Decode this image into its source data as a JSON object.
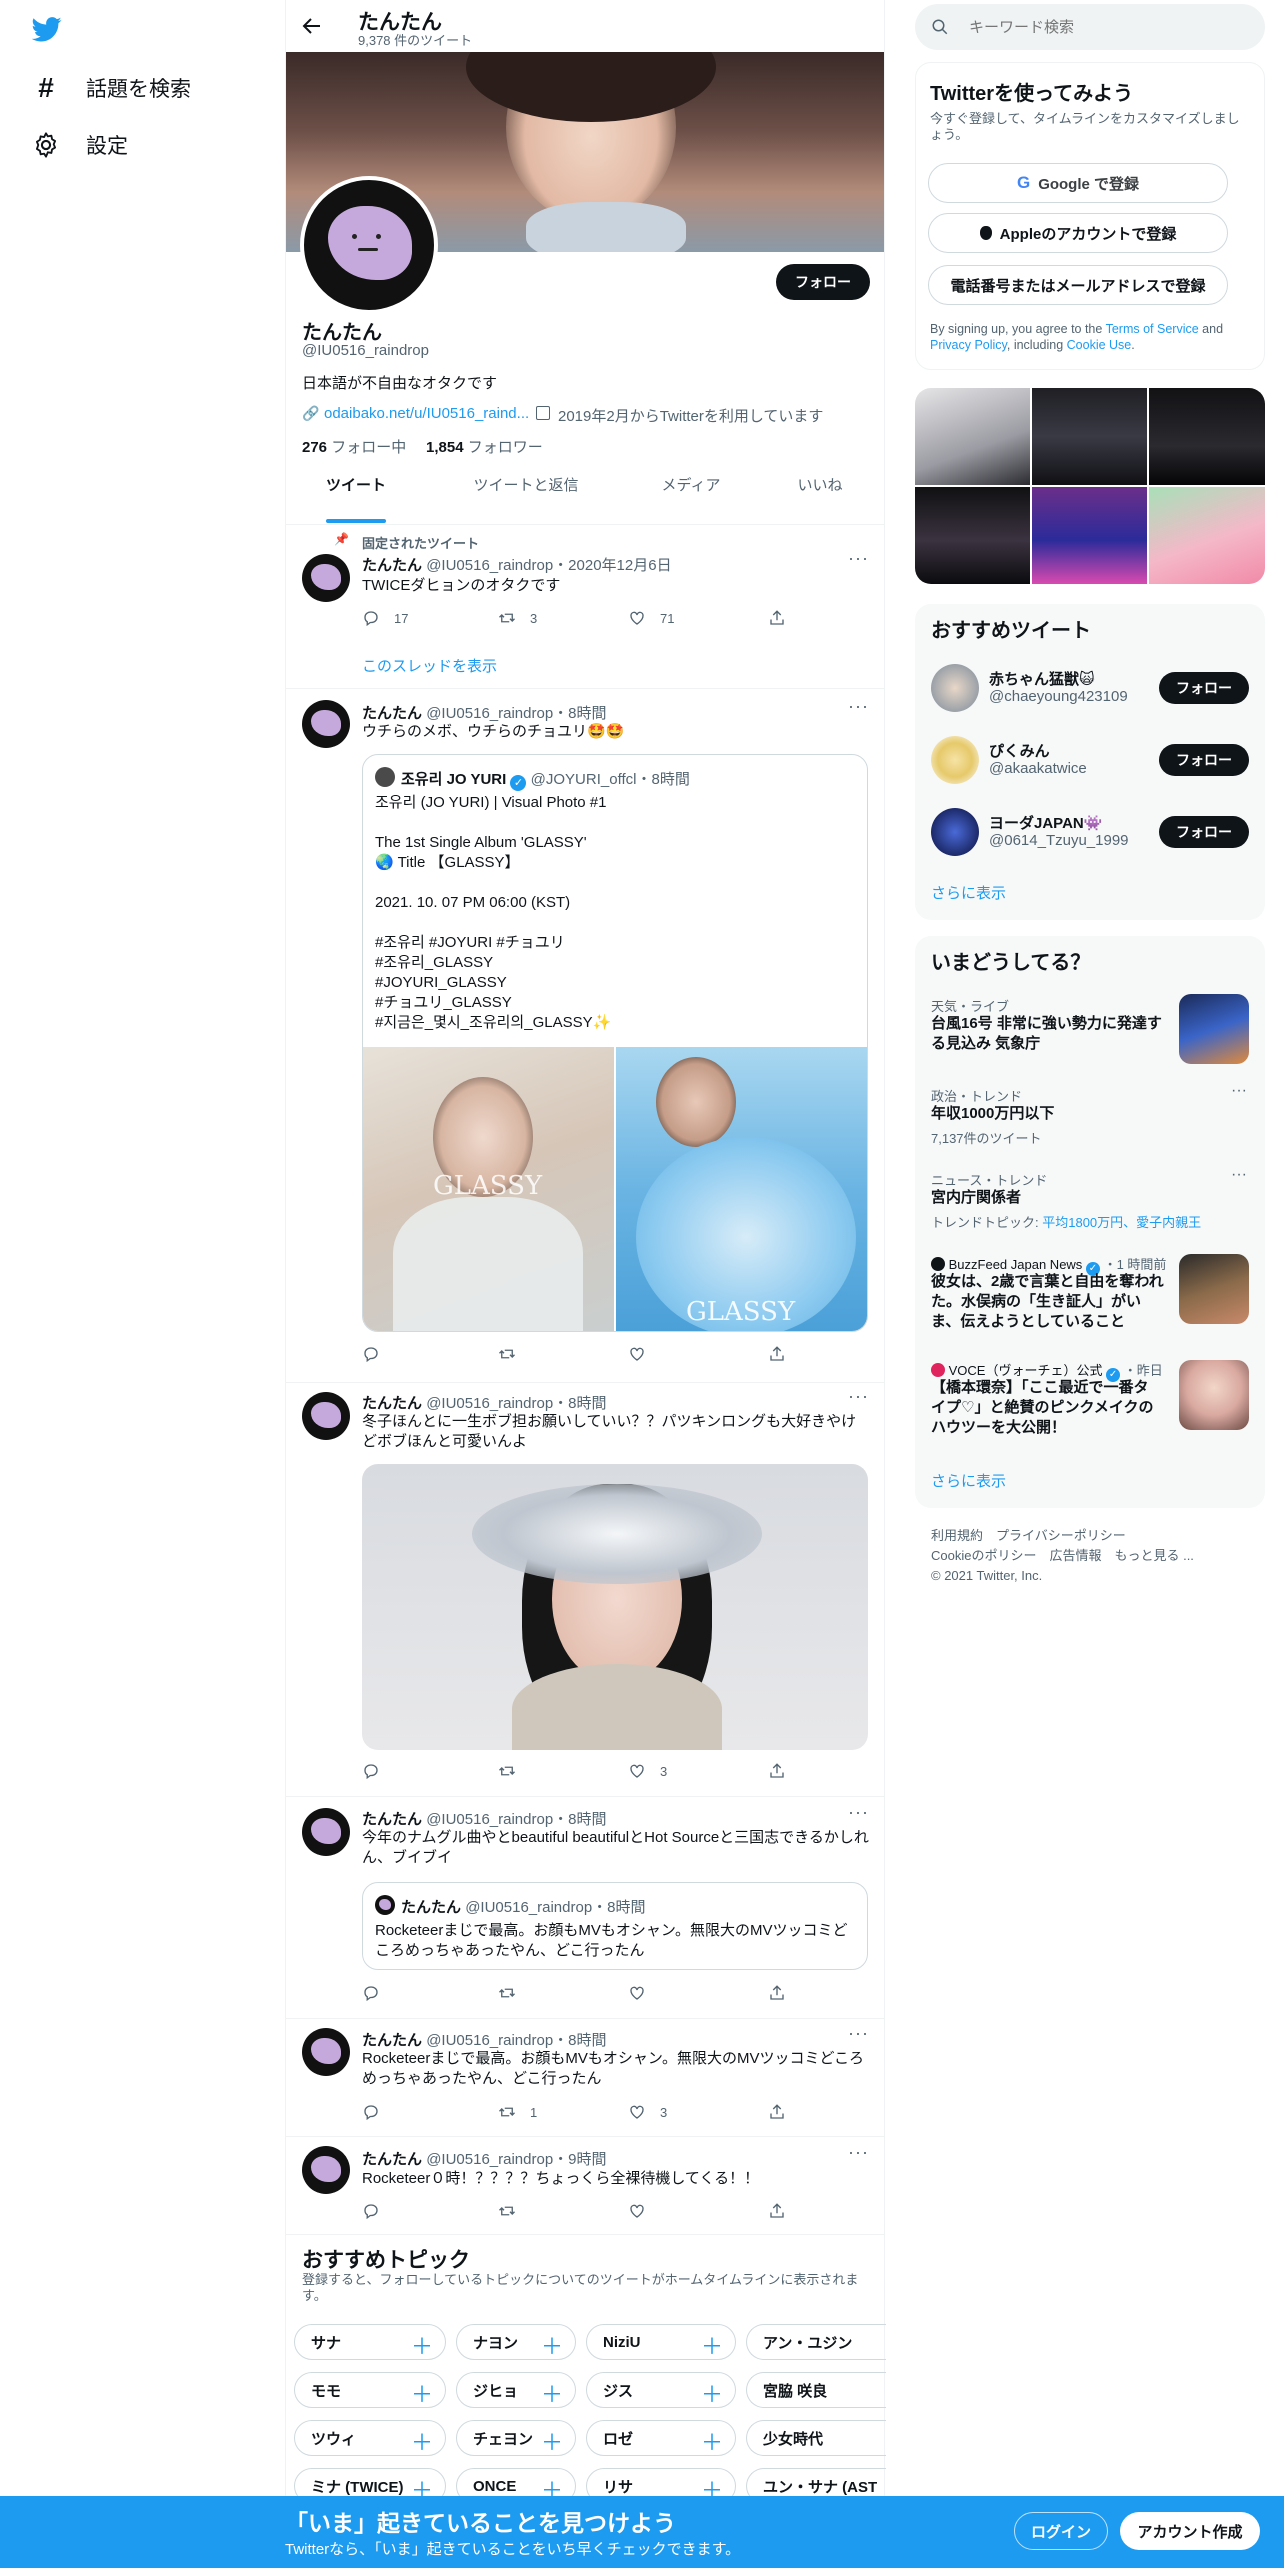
{
  "nav": {
    "explore_label": "話題を検索",
    "settings_label": "設定"
  },
  "profile": {
    "header_name": "たんたん",
    "tweet_count": "9,378 件のツイート",
    "name": "たんたん",
    "handle": "@IU0516_raindrop",
    "bio": "日本語が不自由なオタクです",
    "link": "odaibako.net/u/IU0516_raind...",
    "joined": "2019年2月からTwitterを利用しています",
    "following_count": "276",
    "following_label": "フォロー中",
    "followers_count": "1,854",
    "followers_label": "フォロワー",
    "follow_label": "フォロー"
  },
  "tabs": [
    "ツイート",
    "ツイートと返信",
    "メディア",
    "いいね"
  ],
  "tweets": [
    {
      "pinned_label": "固定されたツイート",
      "name": "たんたん",
      "handle": "@IU0516_raindrop",
      "time": "・2020年12月6日",
      "text": "TWICEダヒョンのオタクです",
      "replies": "17",
      "retweets": "3",
      "likes": "71",
      "thread_label": "このスレッドを表示"
    },
    {
      "name": "たんたん",
      "handle": "@IU0516_raindrop",
      "time": "・8時間",
      "text": "ウチらのメボ、ウチらのチョユリ🤩🤩",
      "quote": {
        "name": "조유리 JO YURI",
        "handle": "@JOYURI_offcl",
        "time": "・8時間",
        "lines": [
          "조유리 (JO YURI) | Visual Photo #1",
          "",
          "The 1st Single Album 'GLASSY'",
          "🌏 Title 【GLASSY】",
          "",
          "2021. 10. 07 PM 06:00 (KST)",
          "",
          "#조유리 #JOYURI #チョユリ",
          "#조유리_GLASSY",
          "#JOYURI_GLASSY",
          "#チョユリ_GLASSY",
          "#지금은_몇시_조유리의_GLASSY✨"
        ],
        "image_text": "GLASSY"
      }
    },
    {
      "name": "たんたん",
      "handle": "@IU0516_raindrop",
      "time": "・8時間",
      "text_line1": "冬子ほんとに一生ボブ担お願いしていい？？パツキンロングも大好きやけ",
      "text_line2": "どボブほんと可愛いんよ",
      "likes": "3"
    },
    {
      "name": "たんたん",
      "handle": "@IU0516_raindrop",
      "time": "・8時間",
      "text_line1": "今年のナムグル曲やとbeautiful beautifulとHot Sourceと三国志できるかしれ",
      "text_line2": "ん、ブイブイ",
      "quote": {
        "name": "たんたん",
        "handle": "@IU0516_raindrop",
        "time": "・8時間",
        "line1": "Rocketeerまじで最高。お顔もMVもオシャン。無限大のMVツッコミど",
        "line2": "ころめっちゃあったやん、どこ行ったん"
      }
    },
    {
      "name": "たんたん",
      "handle": "@IU0516_raindrop",
      "time": "・8時間",
      "text_line1": "Rocketeerまじで最高。お顔もMVもオシャン。無限大のMVツッコミどころ",
      "text_line2": "めっちゃあったやん、どこ行ったん",
      "retweets": "1",
      "likes": "3"
    },
    {
      "name": "たんたん",
      "handle": "@IU0516_raindrop",
      "time": "・9時間",
      "text": "Rocketeer０時！？？？？ちょっくら全裸待機してくる！！"
    }
  ],
  "topics": {
    "title": "おすすめトピック",
    "desc_line1": "登録すると、フォローしているトピックについてのツイートがホームタイムラインに表示されま",
    "desc_line2": "す。",
    "chips": [
      "サナ",
      "ナヨン",
      "NiziU",
      "アン・ユジン",
      "モモ",
      "ジヒョ",
      "ジス",
      "宮脇 咲良",
      "ツウィ",
      "チェヨン",
      "ロゼ",
      "少女時代",
      "ミナ (TWICE)",
      "ONCE",
      "リサ",
      "ユン・サナ (AST"
    ]
  },
  "search": {
    "placeholder": "キーワード検索"
  },
  "signup": {
    "title": "Twitterを使ってみよう",
    "subtitle_line1": "今すぐ登録して、タイムラインをカスタマイズしまし",
    "subtitle_line2": "ょう。",
    "google": "Google で登録",
    "apple": "Appleのアカウントで登録",
    "phone": "電話番号またはメールアドレスで登録",
    "terms_a": "By signing up, you agree to the ",
    "terms_link1": "Terms of Service",
    "terms_b": " and",
    "terms_link2": "Privacy Policy",
    "terms_c": ", including ",
    "terms_link3": "Cookie Use",
    "terms_d": "."
  },
  "recommended": {
    "title": "おすすめツイート",
    "users": [
      {
        "name": "赤ちゃん猛獣🙀",
        "handle": "@chaeyoung423109"
      },
      {
        "name": "ぴくみん",
        "handle": "@akaakatwice"
      },
      {
        "name": "ヨーダJAPAN👾",
        "handle": "@0614_Tzuyu_1999"
      }
    ],
    "follow_label": "フォロー",
    "more_label": "さらに表示"
  },
  "trends": {
    "title": "いまどうしてる？",
    "items": [
      {
        "meta": "天気・ライブ",
        "name_line1": "台風16号 非常に強い勢力に発達す",
        "name_line2": "る見込み 気象庁"
      },
      {
        "meta": "政治・トレンド",
        "name": "年収1000万円以下",
        "sub": "7,137件のツイート"
      },
      {
        "meta": "ニュース・トレンド",
        "name": "宮内庁関係者",
        "sub_prefix": "トレンドトピック: ",
        "sub_links": "平均1800万円、愛子内親王"
      },
      {
        "source": "BuzzFeed Japan News",
        "time": "・1 時間前",
        "line1": "彼女は、2歳で言葉と自由を奪われ",
        "line2": "た。水俣病の「生き証人」がい",
        "line3": "ま、伝えようとしていること"
      },
      {
        "source": "VOCE（ヴォーチェ）公式",
        "time": "・昨日",
        "line1": "【橋本環奈】「ここ最近で一番タ",
        "line2": "イプ♡」と絶賛のピンクメイクの",
        "line3": "ハウツーを大公開！"
      }
    ],
    "more_label": "さらに表示"
  },
  "footer": {
    "line1": "利用規約　プライバシーポリシー",
    "line2": "Cookieのポリシー　広告情報　もっと見る ...",
    "line3": "© 2021 Twitter, Inc."
  },
  "banner": {
    "title": "「いま」起きていることを見つけよう",
    "subtitle": "Twitterなら、「いま」起きていることをいち早くチェックできます。",
    "login": "ログイン",
    "signup": "アカウント作成"
  },
  "colors": {
    "accent": "#1d9bf0",
    "text": "#0f1419",
    "muted": "#536471"
  }
}
